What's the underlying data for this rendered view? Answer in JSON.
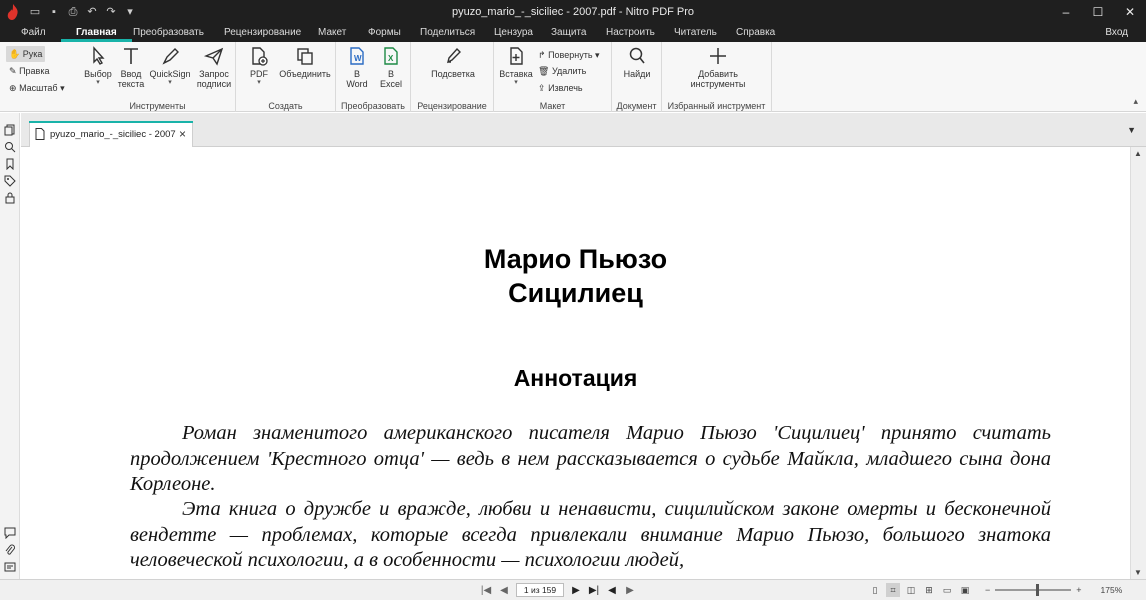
{
  "window": {
    "title": "pyuzo_mario_-_siciliec - 2007.pdf - Nitro PDF Pro",
    "controls": [
      "–",
      "☐",
      "✕"
    ]
  },
  "menu": {
    "tabs": [
      "Файл",
      "Главная",
      "Преобразовать",
      "Рецензирование",
      "Макет",
      "Формы",
      "Поделиться",
      "Цензура",
      "Защита",
      "Настроить",
      "Читатель",
      "Справка"
    ],
    "active": "Главная",
    "login": "Вход"
  },
  "ribbon": {
    "nav": {
      "hand": "Рука",
      "edit": "Правка",
      "zoom": "Масштаб"
    },
    "tools": {
      "select": "Выбор",
      "type_text_1": "Ввод",
      "type_text_2": "текста",
      "quicksign": "QuickSign",
      "request_1": "Запрос",
      "request_2": "подписи",
      "label": "Инструменты"
    },
    "create": {
      "pdf": "PDF",
      "combine": "Объединить",
      "label": "Создать"
    },
    "convert": {
      "word_1": "В",
      "word_2": "Word",
      "excel_1": "В",
      "excel_2": "Excel",
      "label": "Преобразовать"
    },
    "review": {
      "highlight": "Подсветка",
      "label": "Рецензирование"
    },
    "layout": {
      "insert": "Вставка",
      "rotate": "Повернуть",
      "delete": "Удалить",
      "extract": "Извлечь",
      "label": "Макет"
    },
    "document": {
      "find": "Найди",
      "label": "Документ"
    },
    "favorite": {
      "add_1": "Добавить",
      "add_2": "инструменты",
      "label": "Избранный инструмент"
    }
  },
  "doc_tab": {
    "name": "pyuzo_mario_-_siciliec - 2007"
  },
  "document": {
    "author": "Марио Пьюзо",
    "title": "Сицилиец",
    "annotation_heading": "Аннотация",
    "paragraph1": "Роман знаменитого американского писателя Марио Пьюзо 'Сицилиец' принято считать продолжением 'Крестного отца' — ведь в нем рассказывается о судьбе Майкла, младшего сына дона Корлеоне.",
    "paragraph2": "Эта книга о дружбе и вражде, любви и ненависти, сицилийском законе омерты и бесконечной вендетте — проблемах, которые всегда привлекали внимание Марио Пьюзо, большого знатока человеческой психологии, а в особенности — психологии людей,"
  },
  "statusbar": {
    "page_indicator": "1 из 159",
    "zoom_level": "175%",
    "zoom_fraction": 0.55
  },
  "colors": {
    "accent": "#19b3a9",
    "titlebar": "#1f1f1f",
    "logo": "#e0332b"
  }
}
